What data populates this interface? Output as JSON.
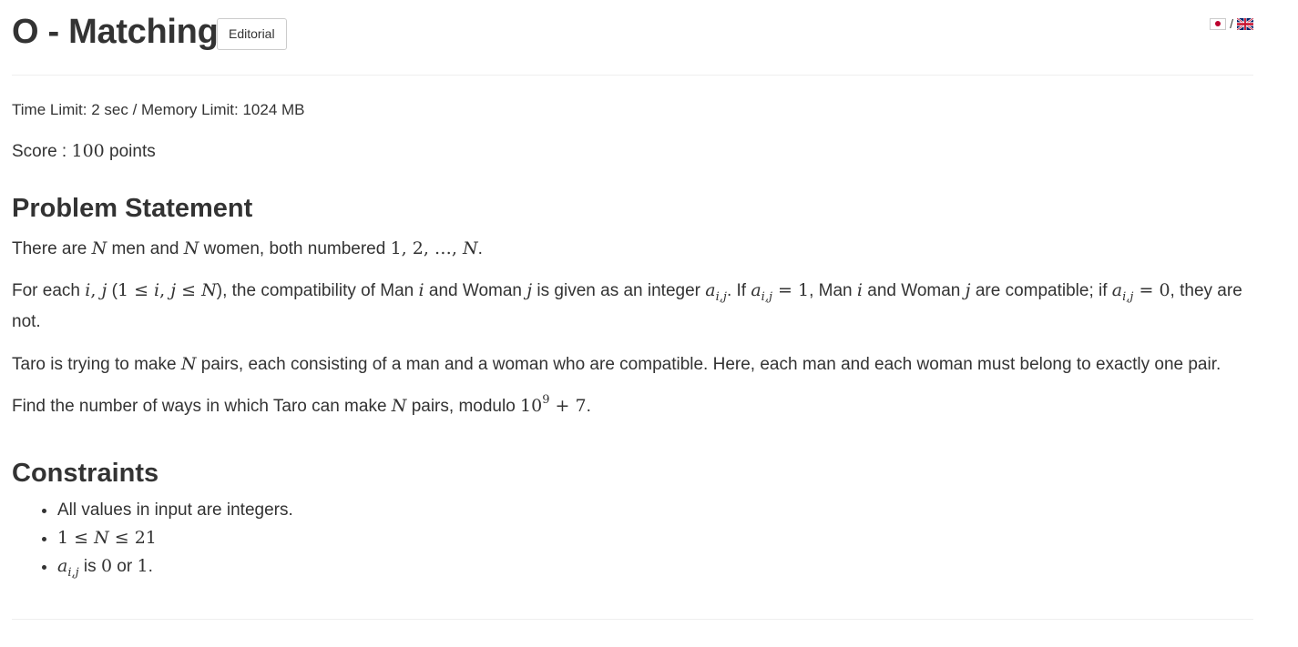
{
  "header": {
    "title": "O - Matching",
    "editorial_label": "Editorial",
    "lang_separator": "/"
  },
  "limits": {
    "text": "Time Limit: 2 sec / Memory Limit: 1024 MB"
  },
  "score": {
    "prefix": "Score : ",
    "value": "100",
    "suffix": " points"
  },
  "problem": {
    "heading": "Problem Statement",
    "p1": {
      "a": "There are ",
      "b": " men and ",
      "c": " women, both numbered ",
      "d": "."
    },
    "p2": {
      "a": "For each ",
      "b": " (",
      "c": "), the compatibility of Man ",
      "d": " and Woman ",
      "e": " is given as an integer ",
      "f": ". If ",
      "g": ", Man ",
      "h": " and Woman ",
      "i": " are compatible; if ",
      "j": ", they are not."
    },
    "p3": {
      "a": "Taro is trying to make ",
      "b": " pairs, each consisting of a man and a woman who are compatible. Here, each man and each woman must belong to exactly one pair."
    },
    "p4": {
      "a": "Find the number of ways in which Taro can make ",
      "b": " pairs, modulo ",
      "c": "."
    }
  },
  "constraints": {
    "heading": "Constraints",
    "item1": "All values in input are integers.",
    "item3_mid": " is ",
    "item3_or": " or ",
    "item3_end": "."
  },
  "icons": {
    "jp_flag": "japan-flag-icon",
    "uk_flag": "uk-flag-icon"
  }
}
